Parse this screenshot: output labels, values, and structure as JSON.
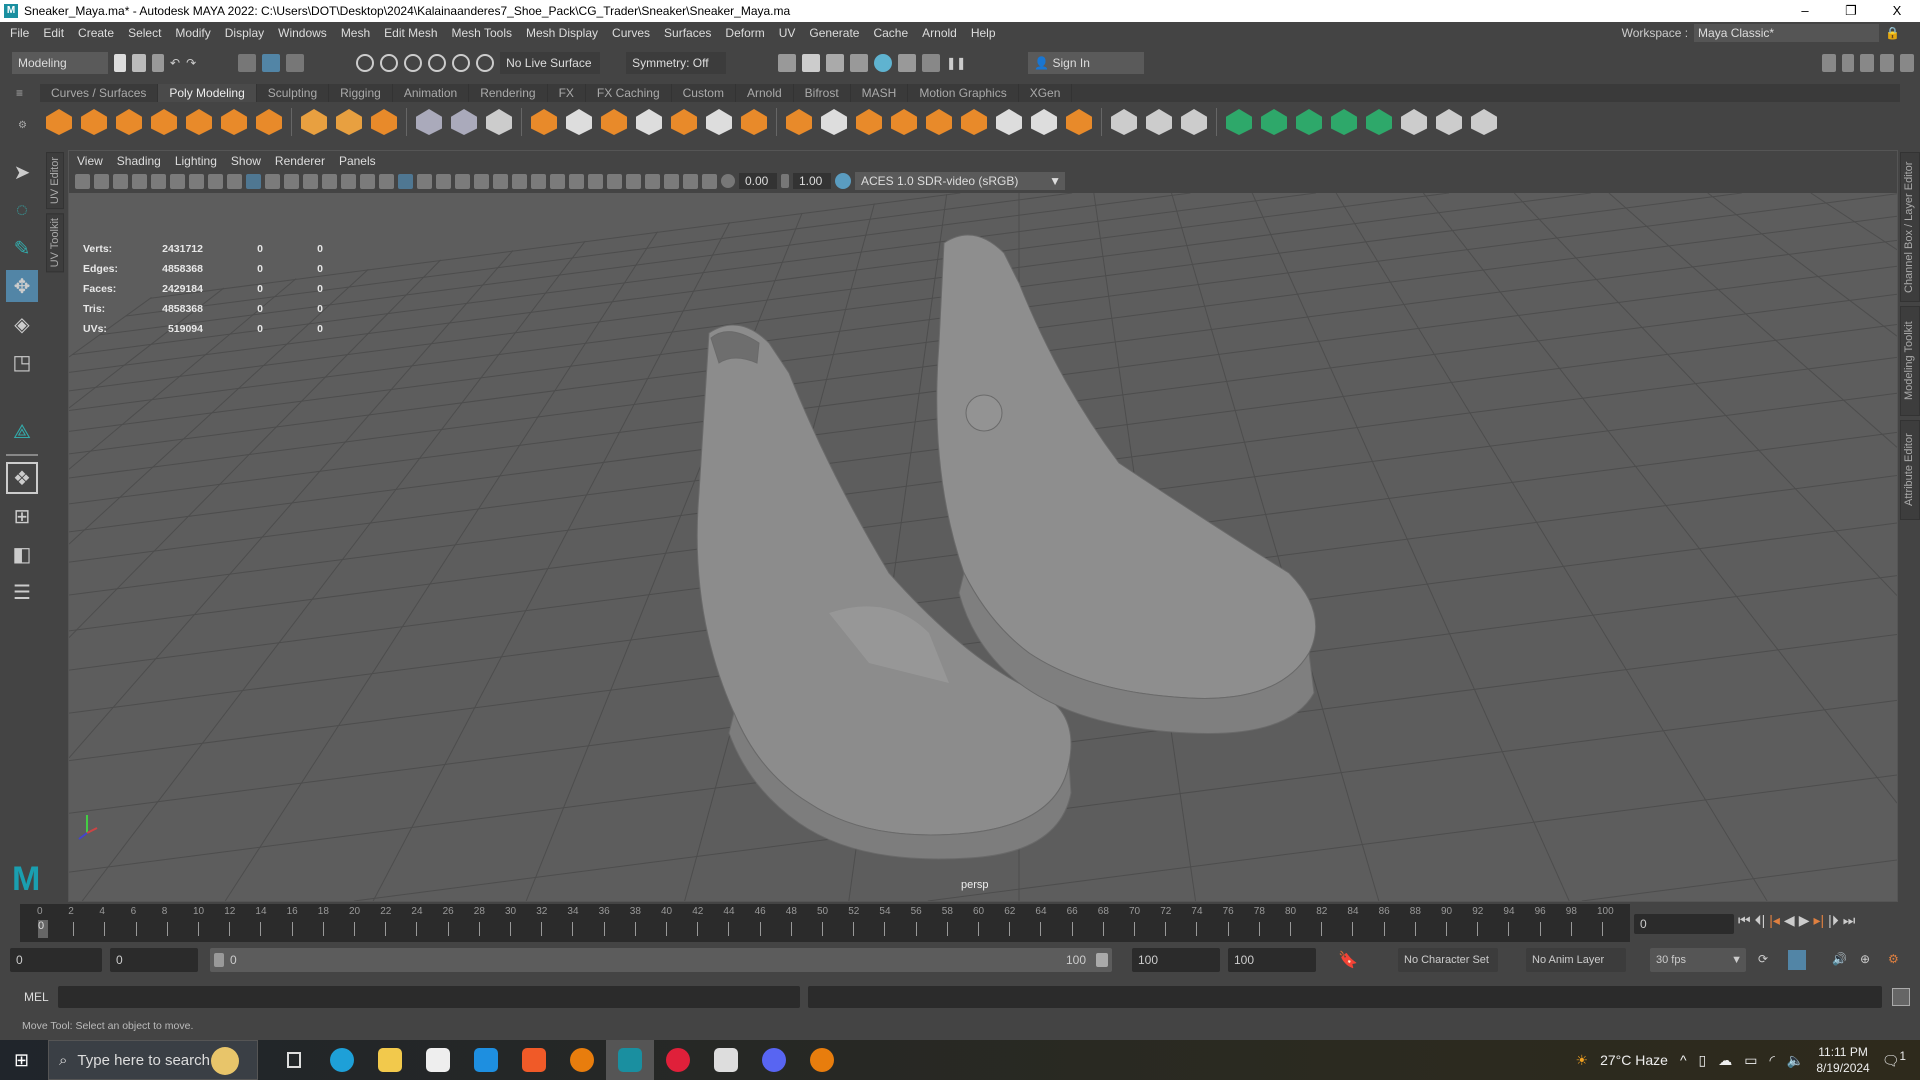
{
  "window": {
    "title": "Sneaker_Maya.ma* - Autodesk MAYA 2022: C:\\Users\\DOT\\Desktop\\2024\\Kalainaanderes7_Shoe_Pack\\CG_Trader\\Sneaker\\Sneaker_Maya.ma",
    "app_icon": "M",
    "minimize": "–",
    "restore": "❐",
    "close": "X"
  },
  "menu": [
    "File",
    "Edit",
    "Create",
    "Select",
    "Modify",
    "Display",
    "Windows",
    "Mesh",
    "Edit Mesh",
    "Mesh Tools",
    "Mesh Display",
    "Curves",
    "Surfaces",
    "Deform",
    "UV",
    "Generate",
    "Cache",
    "Arnold",
    "Help"
  ],
  "workspace": {
    "label": "Workspace :",
    "value": "Maya Classic*"
  },
  "statusline": {
    "mode": "Modeling",
    "live_surface": "No Live Surface",
    "symmetry": "Symmetry: Off",
    "sign_in": "Sign In"
  },
  "shelf_tabs": [
    "Curves / Surfaces",
    "Poly Modeling",
    "Sculpting",
    "Rigging",
    "Animation",
    "Rendering",
    "FX",
    "FX Caching",
    "Custom",
    "Arnold",
    "Bifrost",
    "MASH",
    "Motion Graphics",
    "XGen"
  ],
  "shelf_active": "Poly Modeling",
  "left_tabs": [
    "UV Editor",
    "UV Toolkit"
  ],
  "right_tabs": [
    "Channel Box / Layer Editor",
    "Modeling Toolkit",
    "Attribute Editor"
  ],
  "panel": {
    "menu": [
      "View",
      "Shading",
      "Lighting",
      "Show",
      "Renderer",
      "Panels"
    ],
    "exposure": "0.00",
    "gamma": "1.00",
    "colorspace": "ACES 1.0 SDR-video (sRGB)",
    "camera": "persp"
  },
  "hud": [
    {
      "label": "Verts:",
      "total": "2431712",
      "sel": "0",
      "comp": "0"
    },
    {
      "label": "Edges:",
      "total": "4858368",
      "sel": "0",
      "comp": "0"
    },
    {
      "label": "Faces:",
      "total": "2429184",
      "sel": "0",
      "comp": "0"
    },
    {
      "label": "Tris:",
      "total": "4858368",
      "sel": "0",
      "comp": "0"
    },
    {
      "label": "UVs:",
      "total": "519094",
      "sel": "0",
      "comp": "0"
    }
  ],
  "timeline": {
    "start": 0,
    "end": 100,
    "step": 2,
    "current": "0",
    "current_field": "0"
  },
  "range": {
    "anim_start": "0",
    "start": "0",
    "slider_start": "0",
    "slider_end": "100",
    "end": "100",
    "anim_end": "100",
    "character_set": "No Character Set",
    "anim_layer": "No Anim Layer",
    "fps": "30 fps"
  },
  "mel": {
    "label": "MEL"
  },
  "helpline": "Move Tool: Select an object to move.",
  "taskbar": {
    "search_placeholder": "Type here to search",
    "weather": "27°C  Haze",
    "time": "11:11 PM",
    "date": "8/19/2024",
    "notifications": "1"
  },
  "colors": {
    "accent": "#5285a6",
    "viewport": "#5d5d5d",
    "maya_teal": "#1a8fa0"
  }
}
